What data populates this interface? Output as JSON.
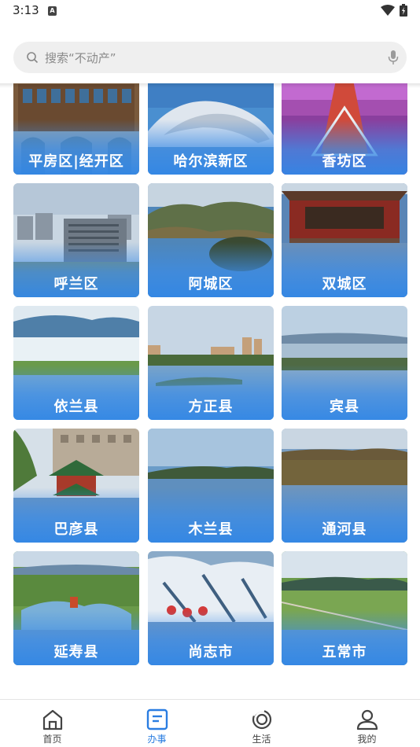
{
  "status_bar": {
    "time": "3:13",
    "notification_icon": "a-icon",
    "wifi_icon": "wifi-icon",
    "battery_icon": "battery-icon"
  },
  "search": {
    "placeholder": "搜索“不动产”",
    "search_icon": "search-icon",
    "voice_icon": "mic-icon"
  },
  "districts": [
    {
      "label": "平房区|经开区"
    },
    {
      "label": "哈尔滨新区"
    },
    {
      "label": "香坊区"
    },
    {
      "label": "呼兰区"
    },
    {
      "label": "阿城区"
    },
    {
      "label": "双城区"
    },
    {
      "label": "依兰县"
    },
    {
      "label": "方正县"
    },
    {
      "label": "宾县"
    },
    {
      "label": "巴彦县"
    },
    {
      "label": "木兰县"
    },
    {
      "label": "通河县"
    },
    {
      "label": "延寿县"
    },
    {
      "label": "尚志市"
    },
    {
      "label": "五常市"
    }
  ],
  "bottom_nav": {
    "items": [
      {
        "label": "首页",
        "icon": "home-icon"
      },
      {
        "label": "办事",
        "icon": "service-icon",
        "active": true
      },
      {
        "label": "生活",
        "icon": "life-icon"
      },
      {
        "label": "我的",
        "icon": "user-icon"
      }
    ]
  },
  "colors": {
    "accent": "#2a7de1",
    "card_overlay": "#3a8ce6"
  }
}
